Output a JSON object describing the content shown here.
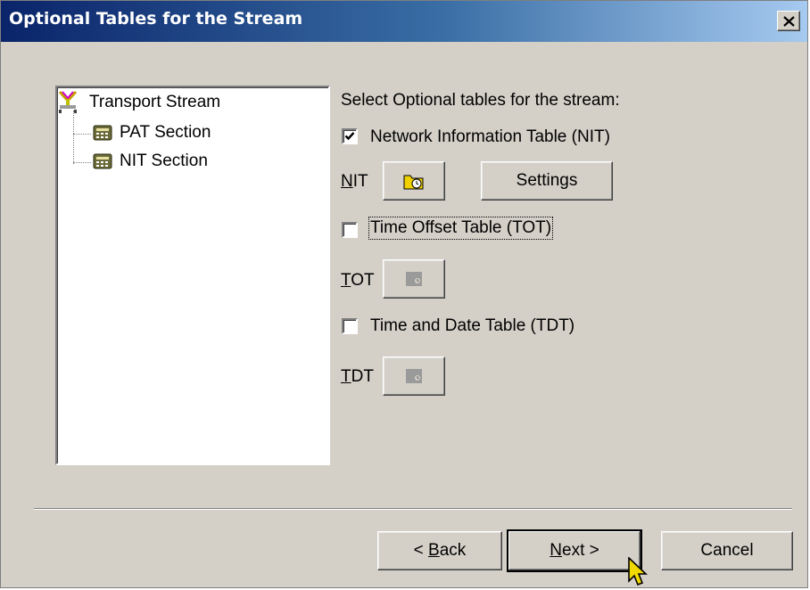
{
  "window": {
    "title": "Optional Tables for the Stream",
    "close_glyph": "×"
  },
  "tree": {
    "items": [
      {
        "label": "Transport Stream",
        "icon": "transport-stream-icon"
      },
      {
        "label": "PAT Section",
        "icon": "table-section-icon"
      },
      {
        "label": "NIT Section",
        "icon": "table-section-icon"
      }
    ]
  },
  "options": {
    "header": "Select Optional tables for the stream:",
    "nit_checkbox": {
      "label": "Network Information Table (NIT)",
      "checked": true
    },
    "nit_row": {
      "label_key": "N",
      "label_rest": "IT",
      "icon": "folder-clock-icon",
      "settings_label": "Settings"
    },
    "tot_checkbox": {
      "label": "Time Offset Table (TOT)",
      "checked": false
    },
    "tot_row": {
      "label_key": "T",
      "label_rest": "OT",
      "icon": "clock-disabled-icon"
    },
    "tdt_checkbox": {
      "label": "Time and Date Table (TDT)",
      "checked": false
    },
    "tdt_row": {
      "label_key": "T",
      "label_rest": "DT",
      "icon": "clock-disabled-icon"
    }
  },
  "footer": {
    "back": {
      "prefix": "< ",
      "key": "B",
      "rest": "ack"
    },
    "next": {
      "key": "N",
      "rest": "ext >"
    },
    "cancel_label": "Cancel"
  },
  "colors": {
    "dialog_bg": "#d4d0c8",
    "title_gradient_start": "#0a246a",
    "title_gradient_end": "#a6caf0"
  }
}
